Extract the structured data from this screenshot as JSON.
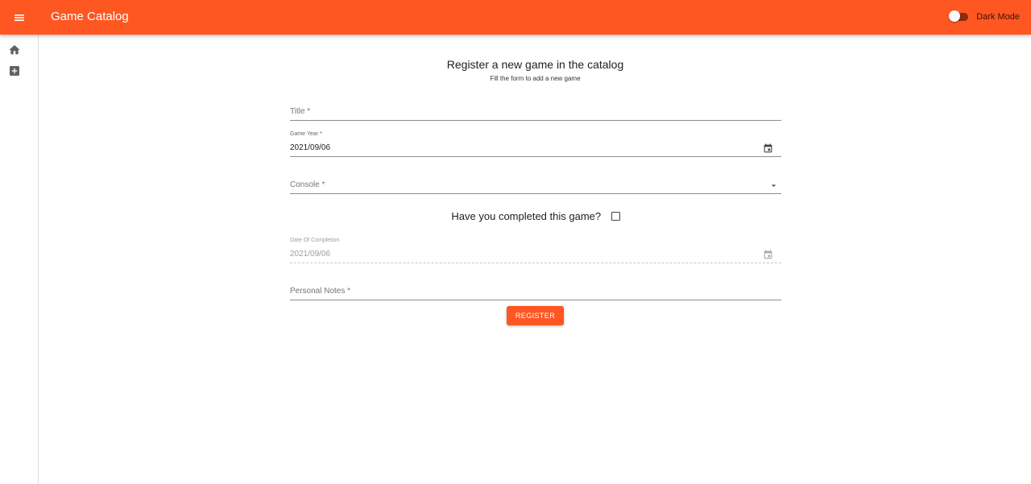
{
  "header": {
    "app_title": "Game Catalog",
    "dark_mode_label": "Dark Mode",
    "dark_mode_on": false,
    "bar_color": "#ff5722"
  },
  "sidebar": {
    "items": [
      {
        "icon": "home-icon"
      },
      {
        "icon": "add-box-icon"
      }
    ]
  },
  "form": {
    "heading": "Register a new game in the catalog",
    "subheading": "Fill the form to add a new game",
    "title_field": {
      "placeholder": "Title *",
      "value": ""
    },
    "year_field": {
      "label": "Game Year *",
      "value": "2021/09/06",
      "icon": "calendar-icon"
    },
    "console_field": {
      "placeholder": "Console *",
      "value": "",
      "icon": "dropdown-arrow-icon"
    },
    "completed": {
      "question": "Have you completed this game?",
      "checked": false
    },
    "completion_field": {
      "label": "Date Of Completion",
      "value": "2021/09/06",
      "disabled": true,
      "icon": "calendar-icon"
    },
    "notes_field": {
      "placeholder": "Personal Notes *",
      "value": ""
    },
    "register_label": "REGISTER"
  }
}
